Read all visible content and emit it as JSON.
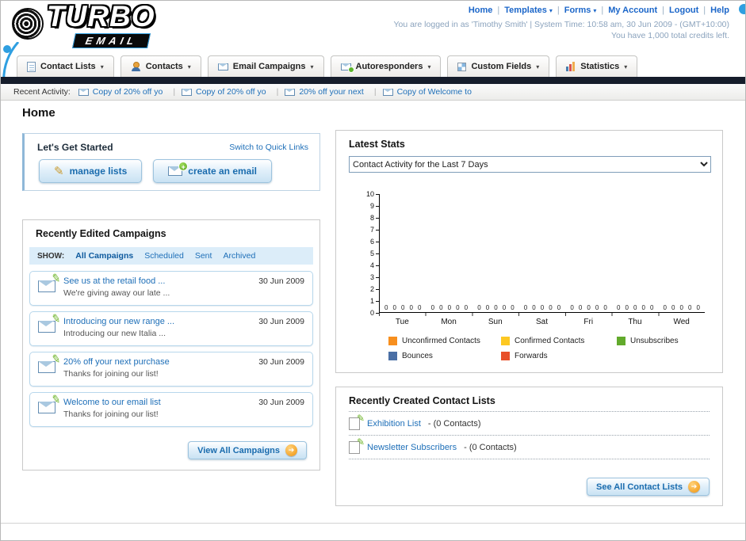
{
  "icons": {
    "chevron_down": "▾",
    "arrow_right": "➔",
    "pencil": "✎",
    "plus": "+"
  },
  "header": {
    "logo_title": "TURBO",
    "logo_subtitle": "EMAIL",
    "top_links": [
      {
        "label": "Home"
      },
      {
        "label": "Templates"
      },
      {
        "label": "Forms"
      },
      {
        "label": "My Account"
      },
      {
        "label": "Logout"
      },
      {
        "label": "Help"
      }
    ],
    "login_line": "You are logged in as 'Timothy Smith' | System Time: 10:58 am, 30 Jun 2009 - (GMT+10:00)",
    "credits_line": "You have 1,000 total credits left."
  },
  "nav": {
    "tabs": [
      {
        "label": "Contact Lists"
      },
      {
        "label": "Contacts"
      },
      {
        "label": "Email Campaigns"
      },
      {
        "label": "Autoresponders"
      },
      {
        "label": "Custom Fields"
      },
      {
        "label": "Statistics"
      }
    ]
  },
  "recent_activity": {
    "label": "Recent Activity:",
    "items": [
      "Copy of 20% off yo",
      "Copy of 20% off yo",
      "20% off your next",
      "Copy of Welcome to"
    ]
  },
  "page": {
    "title": "Home"
  },
  "get_started": {
    "title": "Let's Get Started",
    "switch_link": "Switch to Quick Links",
    "manage_lists_label": "manage lists",
    "create_email_label": "create an email"
  },
  "campaigns": {
    "title": "Recently Edited Campaigns",
    "show_label": "SHOW:",
    "filters": [
      "All Campaigns",
      "Scheduled",
      "Sent",
      "Archived"
    ],
    "active_filter": "All Campaigns",
    "items": [
      {
        "title": "See us at the retail food ...",
        "subtitle": "We're giving away our late ...",
        "date": "30 Jun 2009"
      },
      {
        "title": "Introducing our new range ...",
        "subtitle": "Introducing our new Italia ...",
        "date": "30 Jun 2009"
      },
      {
        "title": "20% off your next purchase",
        "subtitle": "Thanks for joining our list!",
        "date": "30 Jun 2009"
      },
      {
        "title": "Welcome to our email list",
        "subtitle": "Thanks for joining our list!",
        "date": "30 Jun 2009"
      }
    ],
    "view_all_label": "View All Campaigns"
  },
  "stats": {
    "title": "Latest Stats",
    "selected_option": "Contact Activity for the Last 7 Days",
    "legend": [
      {
        "label": "Unconfirmed Contacts",
        "color": "#f78f1e"
      },
      {
        "label": "Confirmed Contacts",
        "color": "#fdc822"
      },
      {
        "label": "Unsubscribes",
        "color": "#62aa2c"
      },
      {
        "label": "Bounces",
        "color": "#4a6fa5"
      },
      {
        "label": "Forwards",
        "color": "#e8502a"
      }
    ]
  },
  "chart_data": {
    "type": "bar",
    "title": "Contact Activity for the Last 7 Days",
    "categories": [
      "Tue",
      "Mon",
      "Sun",
      "Sat",
      "Fri",
      "Thu",
      "Wed"
    ],
    "series": [
      {
        "name": "Unconfirmed Contacts",
        "color": "#f78f1e",
        "values": [
          0,
          0,
          0,
          0,
          0,
          0,
          0
        ]
      },
      {
        "name": "Confirmed Contacts",
        "color": "#fdc822",
        "values": [
          0,
          0,
          0,
          0,
          0,
          0,
          0
        ]
      },
      {
        "name": "Unsubscribes",
        "color": "#62aa2c",
        "values": [
          0,
          0,
          0,
          0,
          0,
          0,
          0
        ]
      },
      {
        "name": "Bounces",
        "color": "#4a6fa5",
        "values": [
          0,
          0,
          0,
          0,
          0,
          0,
          0
        ]
      },
      {
        "name": "Forwards",
        "color": "#e8502a",
        "values": [
          0,
          0,
          0,
          0,
          0,
          0,
          0
        ]
      }
    ],
    "ylim": [
      0,
      10
    ],
    "yticks": [
      0,
      1,
      2,
      3,
      4,
      5,
      6,
      7,
      8,
      9,
      10
    ],
    "grid": false,
    "legend_position": "bottom"
  },
  "contact_lists": {
    "title": "Recently Created Contact Lists",
    "items": [
      {
        "name": "Exhibition List",
        "suffix": "- (0 Contacts)"
      },
      {
        "name": "Newsletter Subscribers",
        "suffix": "- (0 Contacts)"
      }
    ],
    "see_all_label": "See All Contact Lists"
  }
}
